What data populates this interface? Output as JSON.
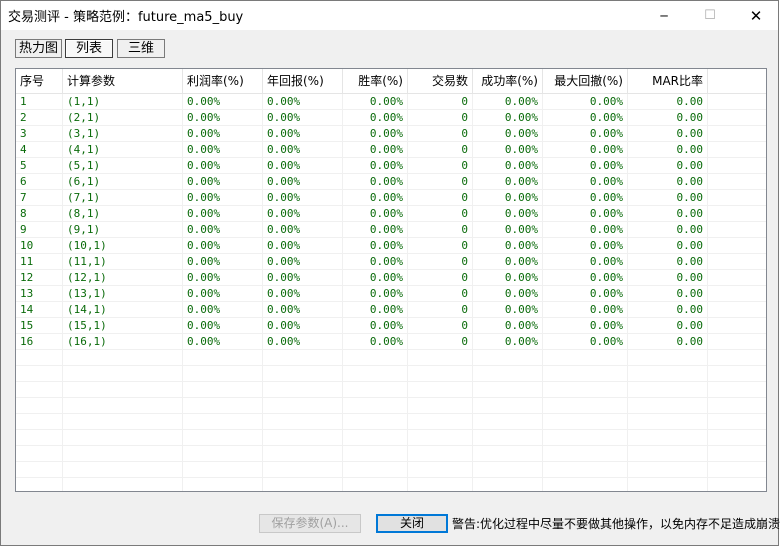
{
  "window": {
    "title": "交易测评 - 策略范例：future_ma5_buy",
    "minimize_glyph": "─",
    "maximize_glyph": "☐",
    "close_glyph": "✕"
  },
  "tabs": [
    {
      "label": "热力图",
      "active": false
    },
    {
      "label": "列表",
      "active": true
    },
    {
      "label": "三维",
      "active": false
    }
  ],
  "table": {
    "columns": [
      "序号",
      "计算参数",
      "利润率(%)",
      "年回报(%)",
      "胜率(%)",
      "交易数",
      "成功率(%)",
      "最大回撤(%)",
      "MAR比率"
    ],
    "rows": [
      [
        "1",
        "(1,1)",
        "0.00%",
        "0.00%",
        "0.00%",
        "0",
        "0.00%",
        "0.00%",
        "0.00"
      ],
      [
        "2",
        "(2,1)",
        "0.00%",
        "0.00%",
        "0.00%",
        "0",
        "0.00%",
        "0.00%",
        "0.00"
      ],
      [
        "3",
        "(3,1)",
        "0.00%",
        "0.00%",
        "0.00%",
        "0",
        "0.00%",
        "0.00%",
        "0.00"
      ],
      [
        "4",
        "(4,1)",
        "0.00%",
        "0.00%",
        "0.00%",
        "0",
        "0.00%",
        "0.00%",
        "0.00"
      ],
      [
        "5",
        "(5,1)",
        "0.00%",
        "0.00%",
        "0.00%",
        "0",
        "0.00%",
        "0.00%",
        "0.00"
      ],
      [
        "6",
        "(6,1)",
        "0.00%",
        "0.00%",
        "0.00%",
        "0",
        "0.00%",
        "0.00%",
        "0.00"
      ],
      [
        "7",
        "(7,1)",
        "0.00%",
        "0.00%",
        "0.00%",
        "0",
        "0.00%",
        "0.00%",
        "0.00"
      ],
      [
        "8",
        "(8,1)",
        "0.00%",
        "0.00%",
        "0.00%",
        "0",
        "0.00%",
        "0.00%",
        "0.00"
      ],
      [
        "9",
        "(9,1)",
        "0.00%",
        "0.00%",
        "0.00%",
        "0",
        "0.00%",
        "0.00%",
        "0.00"
      ],
      [
        "10",
        "(10,1)",
        "0.00%",
        "0.00%",
        "0.00%",
        "0",
        "0.00%",
        "0.00%",
        "0.00"
      ],
      [
        "11",
        "(11,1)",
        "0.00%",
        "0.00%",
        "0.00%",
        "0",
        "0.00%",
        "0.00%",
        "0.00"
      ],
      [
        "12",
        "(12,1)",
        "0.00%",
        "0.00%",
        "0.00%",
        "0",
        "0.00%",
        "0.00%",
        "0.00"
      ],
      [
        "13",
        "(13,1)",
        "0.00%",
        "0.00%",
        "0.00%",
        "0",
        "0.00%",
        "0.00%",
        "0.00"
      ],
      [
        "14",
        "(14,1)",
        "0.00%",
        "0.00%",
        "0.00%",
        "0",
        "0.00%",
        "0.00%",
        "0.00"
      ],
      [
        "15",
        "(15,1)",
        "0.00%",
        "0.00%",
        "0.00%",
        "0",
        "0.00%",
        "0.00%",
        "0.00"
      ],
      [
        "16",
        "(16,1)",
        "0.00%",
        "0.00%",
        "0.00%",
        "0",
        "0.00%",
        "0.00%",
        "0.00"
      ]
    ],
    "text_color": "#0a6b0a"
  },
  "footer": {
    "save_label": "保存参数(A)...",
    "close_label": "关闭",
    "warning": "警告:优化过程中尽量不要做其他操作，以免内存不足造成崩溃"
  }
}
